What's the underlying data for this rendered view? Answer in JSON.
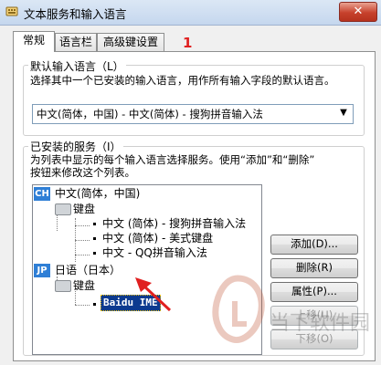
{
  "window": {
    "title": "文本服务和输入语言",
    "close_label": "✕"
  },
  "tabs": [
    {
      "label": "常规",
      "active": true
    },
    {
      "label": "语言栏",
      "active": false
    },
    {
      "label": "高级键设置",
      "active": false
    }
  ],
  "annotation_number": "1",
  "default_language": {
    "group_label": "默认输入语言（L）",
    "description": "选择其中一个已安装的输入语言，用作所有输入字段的默认语言。",
    "selected_value": "中文(简体，中国) - 中文(简体) - 搜狗拼音输入法"
  },
  "installed_services": {
    "group_label": "已安装的服务（I）",
    "description_line1": "为列表中显示的每个输入语言选择服务。使用“添加”和“删除”",
    "description_line2": "按钮来修改这个列表。",
    "tree": {
      "lang1": {
        "badge": "CH",
        "label": "中文(简体，中国)"
      },
      "lang1_keyboard": "键盘",
      "lang1_items": [
        "中文 (简体) - 搜狗拼音输入法",
        "中文 (简体) - 美式键盘",
        "中文 - QQ拼音输入法"
      ],
      "lang2": {
        "badge": "JP",
        "label": "日语（日本）"
      },
      "lang2_keyboard": "键盘",
      "lang2_selected_item": "Baidu IME"
    }
  },
  "buttons": {
    "add": "添加(D)...",
    "remove": "删除(R)",
    "properties": "属性(P)...",
    "move_up": "上移(U)",
    "move_down": "下移(O)"
  },
  "watermark_text": "当下软件园",
  "colors": {
    "selection": "#0c3a8f",
    "annotation": "#e02020",
    "badge": "#2f7fd6"
  }
}
